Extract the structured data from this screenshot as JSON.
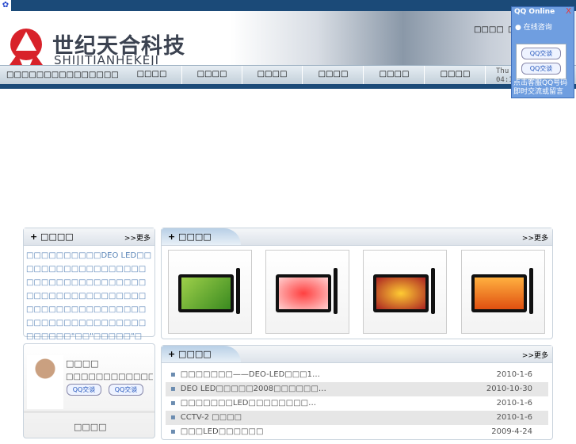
{
  "header": {
    "brand_cn": "世纪天合科技",
    "brand_en": "SHIJITIANHEKEJI",
    "top_links": [
      "□□□□",
      "□"
    ],
    "tagline": "□□□□□□□□□□□□□□□",
    "date_line1": "Thu",
    "date_line2": "04:1"
  },
  "nav": [
    "□□□□",
    "□□□□",
    "□□□□",
    "□□□□",
    "□□□□",
    "□□□□"
  ],
  "qq_widget": {
    "title": "QQ Online",
    "close": "X",
    "consult": "在线咨询",
    "buttons": [
      "QQ交谈",
      "QQ交谈"
    ],
    "footer": "点击客服QQ号码即时交流或留言"
  },
  "about": {
    "title": "□□□□",
    "more": ">>更多",
    "text": "□□□□□□□□□□DEO LED□□□□□□□□□□□□□□□□□□□□□□□□□□□□□□□□□□□□□□□□□□□□□□□□□□□□□□□□□□□□□□□□□□□□□□□□□□□□□□□□□□□□□□□□\"□□\"□□□□□\"□□\"□□□…"
  },
  "products": {
    "title": "□□□□",
    "more": ">>更多"
  },
  "contact": {
    "title": "□□□□",
    "text": "□□□□□□□□□□□□□□□□□□□□□□□□□□",
    "buttons": [
      "QQ交谈",
      "QQ交谈"
    ],
    "title2": "□□□□"
  },
  "news": {
    "title": "□□□□",
    "more": ">>更多",
    "items": [
      {
        "text": "□□□□□□□——DEO-LED□□□1…",
        "date": "2010-1-6"
      },
      {
        "text": "DEO LED□□□□□2008□□□□□□…",
        "date": "2010-10-30"
      },
      {
        "text": "□□□□□□□LED□□□□□□□□…",
        "date": "2010-1-6"
      },
      {
        "text": "CCTV-2 □□□□",
        "date": "2010-1-6"
      },
      {
        "text": "□□□LED□□□□□□",
        "date": "2009-4-24"
      }
    ]
  }
}
